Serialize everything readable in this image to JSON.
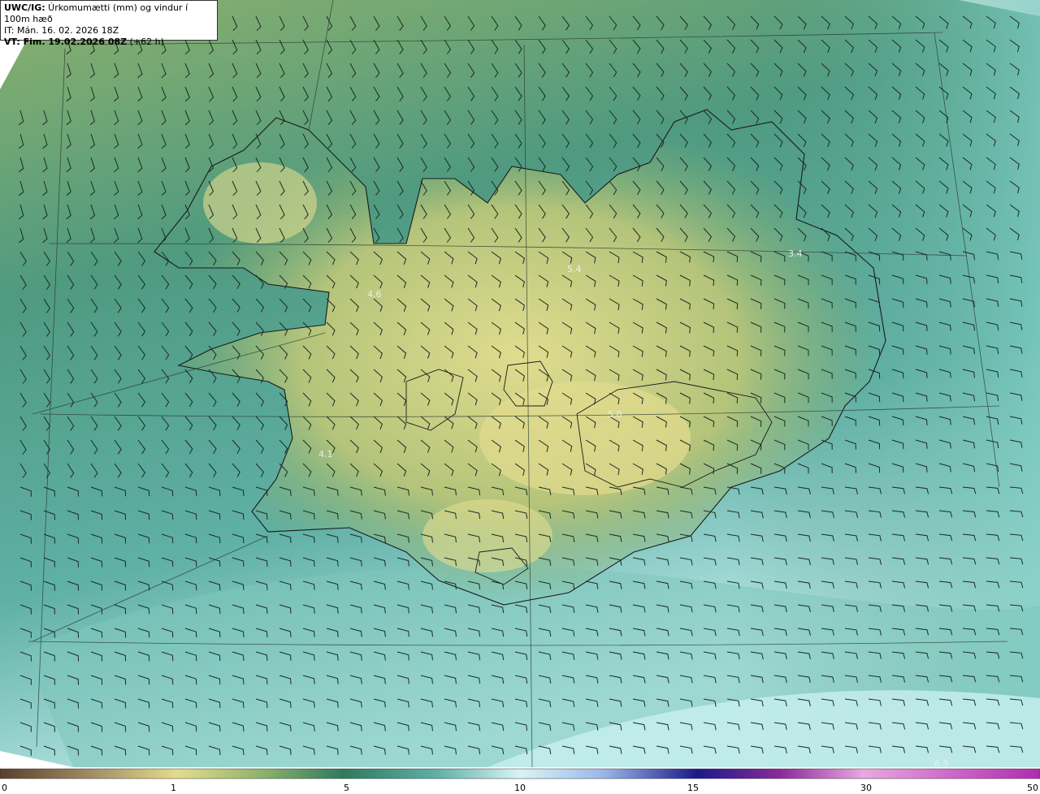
{
  "header": {
    "line1_bold": "UWC/IG:",
    "line1_rest": " Úrkomumætti (mm) og vindur í 100m hæð",
    "line2": "IT: Mán. 16. 02. 2026 18Z",
    "line3_bold": "VT: Fim. 19.02.2026 08Z",
    "line3_rest": " (+62 h)"
  },
  "map_labels": [
    "4.6",
    "5.4",
    "3.4",
    "5.0",
    "4.1",
    "6.9"
  ],
  "legend": {
    "ticks": [
      "0",
      "1",
      "5",
      "10",
      "15",
      "30",
      "50"
    ],
    "colors": [
      "#5a3f2a",
      "#9a8660",
      "#e4dc8c",
      "#8fb46c",
      "#2f7a5e",
      "#9ad8d0",
      "#d8f4f6",
      "#9ab8e8",
      "#1a1a8a",
      "#8a2a9a",
      "#e8a8e0",
      "#b02ab0"
    ]
  },
  "colors": {
    "sea_dark": "#2f6f63",
    "sea_mid": "#5aa69c",
    "sea_light": "#c4eeee",
    "land_yellow": "#d8d88a",
    "land_green": "#8ab06c"
  }
}
